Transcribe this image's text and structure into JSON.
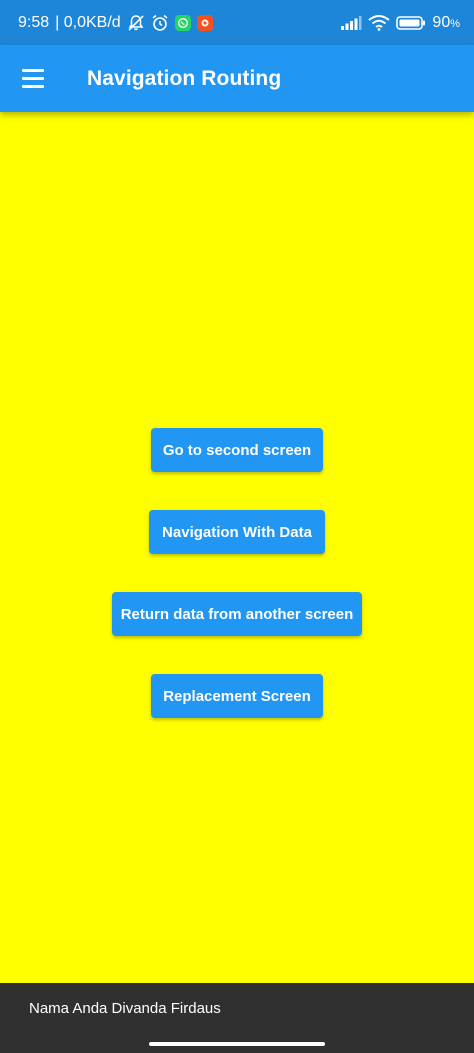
{
  "status_bar": {
    "time": "9:58",
    "network_speed": "| 0,0KB/d",
    "battery_percent": "90",
    "battery_unit": "%",
    "icons": [
      "muted-notification-icon",
      "alarm-icon",
      "whatsapp-icon",
      "app-notification-icon",
      "signal-icon",
      "wifi-icon",
      "battery-icon"
    ],
    "colors": {
      "background": "#1d86d8",
      "whatsapp": "#25d366",
      "app_badge": "#f4511e"
    }
  },
  "app_bar": {
    "title": "Navigation Routing",
    "menu_icon": "hamburger-menu-icon",
    "color": "#2196f3"
  },
  "main": {
    "background": "#ffff00",
    "buttons": [
      {
        "label": "Go to second screen"
      },
      {
        "label": "Navigation With Data"
      },
      {
        "label": "Return data from another screen"
      },
      {
        "label": "Replacement Screen"
      }
    ],
    "button_color": "#2196f3"
  },
  "footer": {
    "text": "Nama Anda Divanda Firdaus",
    "background": "#303030"
  }
}
